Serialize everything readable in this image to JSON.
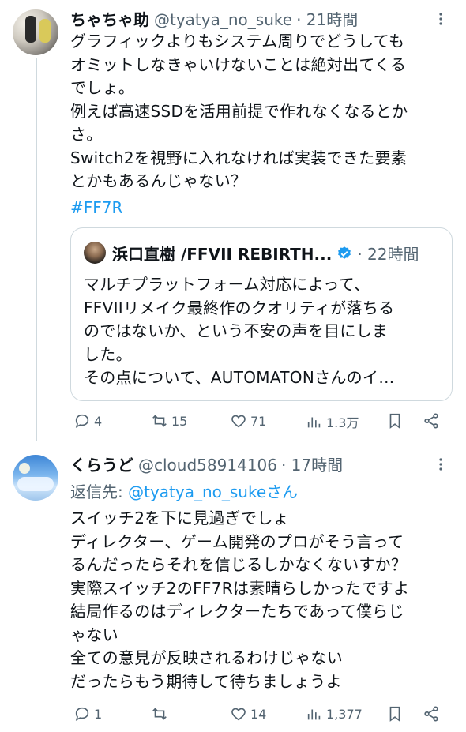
{
  "tweet1": {
    "display_name": "ちゃちゃ助",
    "handle": "@tyatya_no_suke",
    "time": "· 21時間",
    "text": "グラフィックよりもシステム周りでどうしても\nオミットしなきゃいけないことは絶対出てくる\nでしょ。\n例えば高速SSDを活用前提で作れなくなるとか\nさ。\nSwitch2を視野に入れなければ実装できた要素\nとかもあるんじゃない？",
    "hashtag": "#FF7R",
    "quote": {
      "name": "浜口直樹 /FFVII REBIRTH...",
      "time": "· 22時間",
      "text": "マルチプラットフォーム対応によって、\nFFVIIリメイク最終作のクオリティが落ちる\nのではないか、という不安の声を目にしま\nした。\nその点について、AUTOMATONさんのイ…"
    },
    "actions": {
      "reply_count": "4",
      "retweet_count": "15",
      "like_count": "71",
      "views_count": "1.3万"
    }
  },
  "tweet2": {
    "display_name": "くらうど",
    "handle": "@cloud58914106",
    "time": "· 17時間",
    "reply_to_label": "返信先: ",
    "reply_to_mention": "@tyatya_no_sukeさん",
    "text": "スイッチ2を下に見過ぎでしょ\nディレクター、ゲーム開発のプロがそう言って\nるんだったらそれを信じるしかなくないすか？\n実際スイッチ2のFF7Rは素晴らしかったですよ\n結局作るのはディレクターたちであって僕らじ\nゃない\n全ての意見が反映されるわけじゃない\nだったらもう期待して待ちましょうよ",
    "actions": {
      "reply_count": "1",
      "retweet_count": "",
      "like_count": "14",
      "views_count": "1,377"
    }
  },
  "colors": {
    "link": "#1d9bf0",
    "secondary_text": "#536471",
    "border": "#cfd9de"
  }
}
